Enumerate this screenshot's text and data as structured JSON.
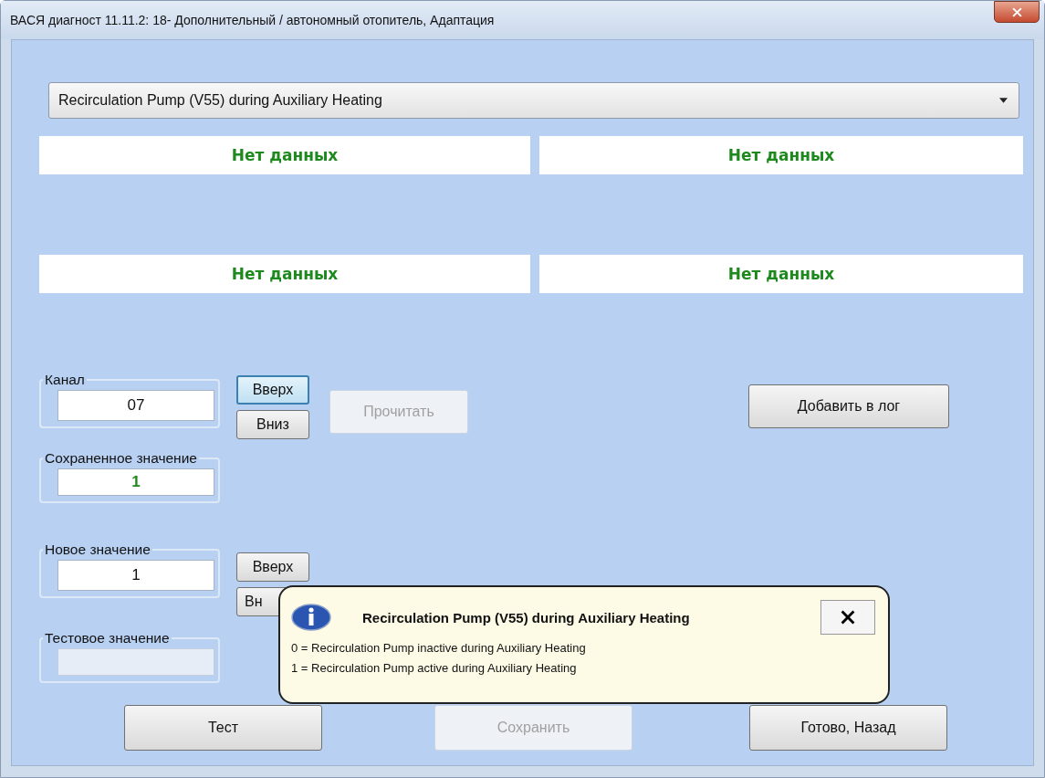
{
  "window": {
    "title": "ВАСЯ диагност 11.11.2: 18- Дополнительный / автономный отопитель, Адаптация"
  },
  "parameter_select": {
    "value": "Recirculation Pump (V55) during Auxiliary Heating"
  },
  "readouts": [
    "Нет данных",
    "Нет данных",
    "Нет данных",
    "Нет данных"
  ],
  "channel": {
    "label": "Канал",
    "value": "07",
    "up": {
      "label": "Вверх",
      "focused": true
    },
    "down": {
      "label": "Вниз",
      "focused": false
    }
  },
  "read_button": {
    "label": "Прочитать",
    "disabled": true
  },
  "add_log_button": {
    "label": "Добавить в лог",
    "disabled": false
  },
  "saved_value": {
    "label": "Сохраненное значение",
    "value": "1"
  },
  "new_value": {
    "label": "Новое значение",
    "value": "1",
    "up": {
      "label": "Вверх",
      "focused": false
    },
    "down": {
      "label": "Вн",
      "focused": false
    }
  },
  "test_value": {
    "label": "Тестовое значение",
    "disabled": true
  },
  "buttons": [
    {
      "label": "Тест",
      "disabled": false
    },
    {
      "label": "Сохранить",
      "disabled": true
    },
    {
      "label": "Готово, Назад",
      "disabled": false
    }
  ],
  "tooltip": {
    "title": "Recirculation Pump (V55) during Auxiliary Heating",
    "lines": [
      "0 = Recirculation Pump inactive during Auxiliary Heating",
      "1 = Recirculation Pump active during Auxiliary Heating"
    ]
  }
}
